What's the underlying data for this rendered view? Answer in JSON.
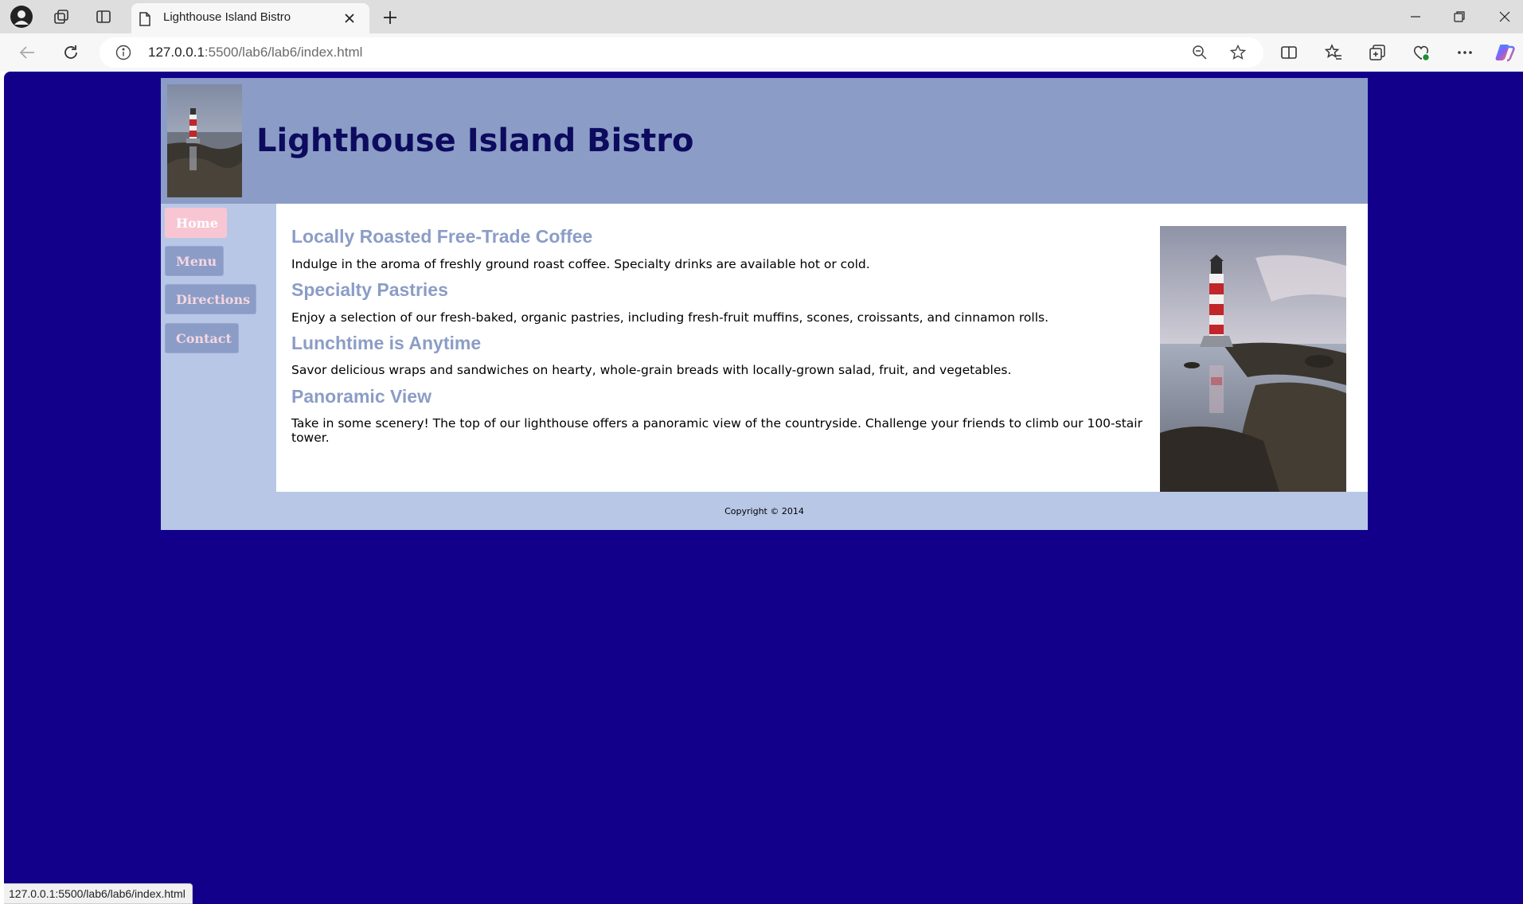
{
  "browser": {
    "tab_title": "Lighthouse Island Bistro",
    "url_host": "127.0.0.1",
    "url_rest": ":5500/lab6/lab6/index.html",
    "status_url": "127.0.0.1:5500/lab6/lab6/index.html",
    "icons": [
      "profile-icon",
      "workspaces-icon",
      "vertical-tabs-icon",
      "page-icon",
      "close-icon",
      "plus-icon",
      "minimize-icon",
      "restore-icon",
      "close-window-icon",
      "back-icon",
      "refresh-icon",
      "info-icon",
      "zoom-out-icon",
      "favorite-star-icon",
      "split-screen-icon",
      "favorites-icon",
      "collections-icon",
      "browser-essentials-icon",
      "more-icon",
      "copilot-icon"
    ]
  },
  "site": {
    "title": "Lighthouse Island Bistro",
    "nav": [
      {
        "label": "Home",
        "active": true
      },
      {
        "label": "Menu",
        "active": false
      },
      {
        "label": "Directions",
        "active": false
      },
      {
        "label": "Contact",
        "active": false
      }
    ],
    "sections": [
      {
        "heading": "Locally Roasted Free-Trade Coffee",
        "text": "Indulge in the aroma of freshly ground roast coffee. Specialty drinks are available hot or cold."
      },
      {
        "heading": "Specialty Pastries",
        "text": "Enjoy a selection of our fresh-baked, organic pastries, including fresh-fruit muffins, scones, croissants, and cinnamon rolls."
      },
      {
        "heading": "Lunchtime is Anytime",
        "text": "Savor delicious wraps and sandwiches on hearty, whole-grain breads with locally-grown salad, fruit, and vegetables."
      },
      {
        "heading": "Panoramic View",
        "text": "Take in some scenery! The top of our lighthouse offers a panoramic view of the countryside. Challenge your friends to climb our 100-stair tower."
      }
    ],
    "footer": "Copyright © 2014"
  },
  "colors": {
    "page_background": "#12008b",
    "header_background": "#8b9dc6",
    "nav_background": "#b8c7e6",
    "title_color": "#0d0b5e",
    "heading_color": "#8b9dc6",
    "active_nav": "#f8c6d3"
  }
}
